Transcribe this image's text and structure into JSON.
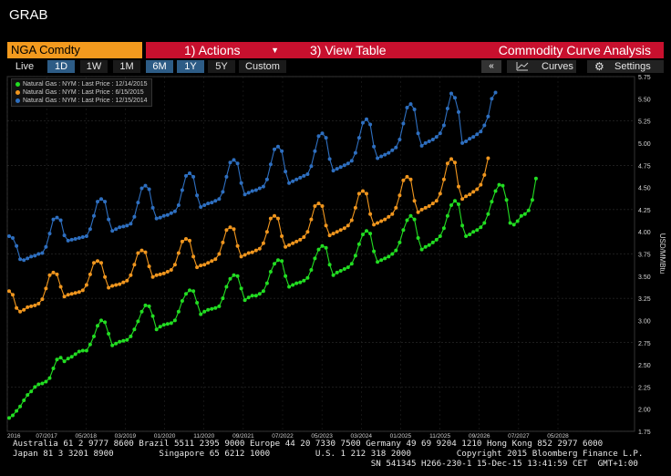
{
  "window_title": "GRAB",
  "toolbar": {
    "ticker": "NGA Comdty",
    "actions_label": "1) Actions",
    "view_table_label": "3) View Table",
    "analysis_label": "Commodity Curve Analysis"
  },
  "ranges": [
    "Live",
    "1D",
    "1W",
    "1M",
    "6M",
    "1Y",
    "5Y",
    "Custom"
  ],
  "selected_ranges": [
    "1D",
    "6M",
    "1Y"
  ],
  "controls": {
    "collapse": "«",
    "curves": "Curves",
    "settings": "Settings"
  },
  "chart_data": {
    "type": "line",
    "ylabel": "USD/MMBtu",
    "yticks": [
      "1.75",
      "2.00",
      "2.25",
      "2.50",
      "2.75",
      "3.00",
      "3.25",
      "3.50",
      "3.75",
      "4.00",
      "4.25",
      "4.50",
      "4.75",
      "5.00",
      "5.25",
      "5.50",
      "5.75"
    ],
    "ylim": [
      1.75,
      5.75
    ],
    "x_tick_labels": [
      "2016",
      "07/2017",
      "05/2018",
      "03/2019",
      "01/2020",
      "11/2020",
      "09/2021",
      "07/2022",
      "05/2023",
      "03/2024",
      "01/2025",
      "11/2025",
      "09/2026",
      "07/2027",
      "05/2028"
    ],
    "grid": true,
    "legend_position": "top-left",
    "series": [
      {
        "name": "Natural Gas : NYM : Last Price : 12/14/2015",
        "color": "#22dd22",
        "start_index": 0,
        "values": [
          1.9,
          1.93,
          1.98,
          2.03,
          2.1,
          2.16,
          2.2,
          2.25,
          2.28,
          2.29,
          2.31,
          2.35,
          2.46,
          2.56,
          2.58,
          2.54,
          2.57,
          2.59,
          2.62,
          2.65,
          2.66,
          2.66,
          2.73,
          2.82,
          2.94,
          3.0,
          2.98,
          2.85,
          2.72,
          2.74,
          2.76,
          2.77,
          2.78,
          2.82,
          2.9,
          2.99,
          3.1,
          3.17,
          3.16,
          3.05,
          2.9,
          2.93,
          2.95,
          2.96,
          2.97,
          3.0,
          3.1,
          3.22,
          3.3,
          3.34,
          3.33,
          3.2,
          3.07,
          3.1,
          3.12,
          3.13,
          3.14,
          3.16,
          3.25,
          3.38,
          3.47,
          3.51,
          3.5,
          3.36,
          3.23,
          3.26,
          3.28,
          3.28,
          3.3,
          3.33,
          3.42,
          3.55,
          3.64,
          3.68,
          3.67,
          3.5,
          3.38,
          3.4,
          3.42,
          3.43,
          3.45,
          3.48,
          3.57,
          3.7,
          3.8,
          3.84,
          3.82,
          3.63,
          3.51,
          3.54,
          3.56,
          3.58,
          3.6,
          3.64,
          3.73,
          3.86,
          3.97,
          4.01,
          3.98,
          3.78,
          3.66,
          3.68,
          3.7,
          3.72,
          3.75,
          3.79,
          3.88,
          4.02,
          4.13,
          4.18,
          4.14,
          3.93,
          3.8,
          3.83,
          3.85,
          3.88,
          3.91,
          3.95,
          4.04,
          4.18,
          4.3,
          4.35,
          4.31,
          4.07,
          3.95,
          3.97,
          4.0,
          4.02,
          4.05,
          4.1,
          4.2,
          4.34,
          4.46,
          4.53,
          4.52,
          4.36,
          4.1,
          4.08,
          4.12,
          4.18,
          4.2,
          4.24,
          4.36,
          4.6
        ]
      },
      {
        "name": "Natural Gas : NYM : Last Price : 6/15/2015",
        "color": "#f0961e",
        "start_index": 0,
        "values": [
          3.33,
          3.29,
          3.14,
          3.1,
          3.12,
          3.15,
          3.16,
          3.17,
          3.19,
          3.24,
          3.36,
          3.51,
          3.54,
          3.52,
          3.38,
          3.27,
          3.29,
          3.3,
          3.31,
          3.32,
          3.34,
          3.4,
          3.52,
          3.65,
          3.67,
          3.65,
          3.49,
          3.37,
          3.39,
          3.4,
          3.41,
          3.43,
          3.45,
          3.51,
          3.63,
          3.76,
          3.79,
          3.77,
          3.61,
          3.49,
          3.51,
          3.52,
          3.53,
          3.55,
          3.57,
          3.63,
          3.76,
          3.89,
          3.92,
          3.9,
          3.72,
          3.6,
          3.62,
          3.63,
          3.65,
          3.67,
          3.69,
          3.75,
          3.88,
          4.02,
          4.05,
          4.03,
          3.84,
          3.72,
          3.74,
          3.76,
          3.77,
          3.79,
          3.81,
          3.87,
          4.0,
          4.15,
          4.18,
          4.15,
          3.95,
          3.83,
          3.85,
          3.87,
          3.89,
          3.91,
          3.94,
          4.0,
          4.14,
          4.29,
          4.32,
          4.29,
          4.07,
          3.96,
          3.98,
          4.0,
          4.02,
          4.04,
          4.07,
          4.13,
          4.27,
          4.43,
          4.46,
          4.43,
          4.2,
          4.08,
          4.1,
          4.12,
          4.14,
          4.17,
          4.2,
          4.27,
          4.41,
          4.58,
          4.62,
          4.59,
          4.35,
          4.22,
          4.25,
          4.27,
          4.29,
          4.32,
          4.35,
          4.43,
          4.59,
          4.77,
          4.82,
          4.78,
          4.51,
          4.37,
          4.4,
          4.42,
          4.45,
          4.48,
          4.53,
          4.64,
          4.83
        ]
      },
      {
        "name": "Natural Gas : NYM : Last Price : 12/15/2014",
        "color": "#2e6fc0",
        "start_index": 0,
        "values": [
          3.95,
          3.93,
          3.84,
          3.69,
          3.68,
          3.7,
          3.72,
          3.73,
          3.75,
          3.76,
          3.83,
          3.98,
          4.14,
          4.16,
          4.13,
          3.96,
          3.9,
          3.91,
          3.92,
          3.93,
          3.94,
          3.95,
          4.03,
          4.18,
          4.34,
          4.37,
          4.34,
          4.14,
          4.01,
          4.03,
          4.05,
          4.06,
          4.07,
          4.09,
          4.17,
          4.33,
          4.49,
          4.52,
          4.48,
          4.27,
          4.15,
          4.16,
          4.18,
          4.19,
          4.21,
          4.23,
          4.3,
          4.47,
          4.63,
          4.66,
          4.62,
          4.41,
          4.28,
          4.3,
          4.32,
          4.33,
          4.35,
          4.37,
          4.45,
          4.62,
          4.78,
          4.81,
          4.77,
          4.55,
          4.42,
          4.44,
          4.46,
          4.47,
          4.49,
          4.51,
          4.59,
          4.76,
          4.93,
          4.96,
          4.91,
          4.68,
          4.55,
          4.57,
          4.59,
          4.61,
          4.63,
          4.65,
          4.74,
          4.91,
          5.08,
          5.11,
          5.06,
          4.82,
          4.69,
          4.71,
          4.73,
          4.75,
          4.77,
          4.8,
          4.89,
          5.06,
          5.23,
          5.27,
          5.21,
          4.96,
          4.83,
          4.85,
          4.87,
          4.89,
          4.92,
          4.95,
          5.04,
          5.22,
          5.4,
          5.44,
          5.38,
          5.11,
          4.97,
          5.0,
          5.02,
          5.04,
          5.07,
          5.11,
          5.2,
          5.39,
          5.56,
          5.51,
          5.35,
          5.0,
          5.02,
          5.05,
          5.07,
          5.1,
          5.13,
          5.2,
          5.3,
          5.5,
          5.57
        ]
      }
    ]
  },
  "footer": {
    "line1": "Australia 61 2 9777 8600 Brazil 5511 2395 9000 Europe 44 20 7330 7500 Germany 49 69 9204 1210 Hong Kong 852 2977 6000",
    "line2": "Japan 81 3 3201 8900         Singapore 65 6212 1000         U.S. 1 212 318 2000         Copyright 2015 Bloomberg Finance L.P.",
    "line3": "                                                                       SN 541345 H266-230-1 15-Dec-15 13:41:59 CET  GMT+1:00"
  }
}
